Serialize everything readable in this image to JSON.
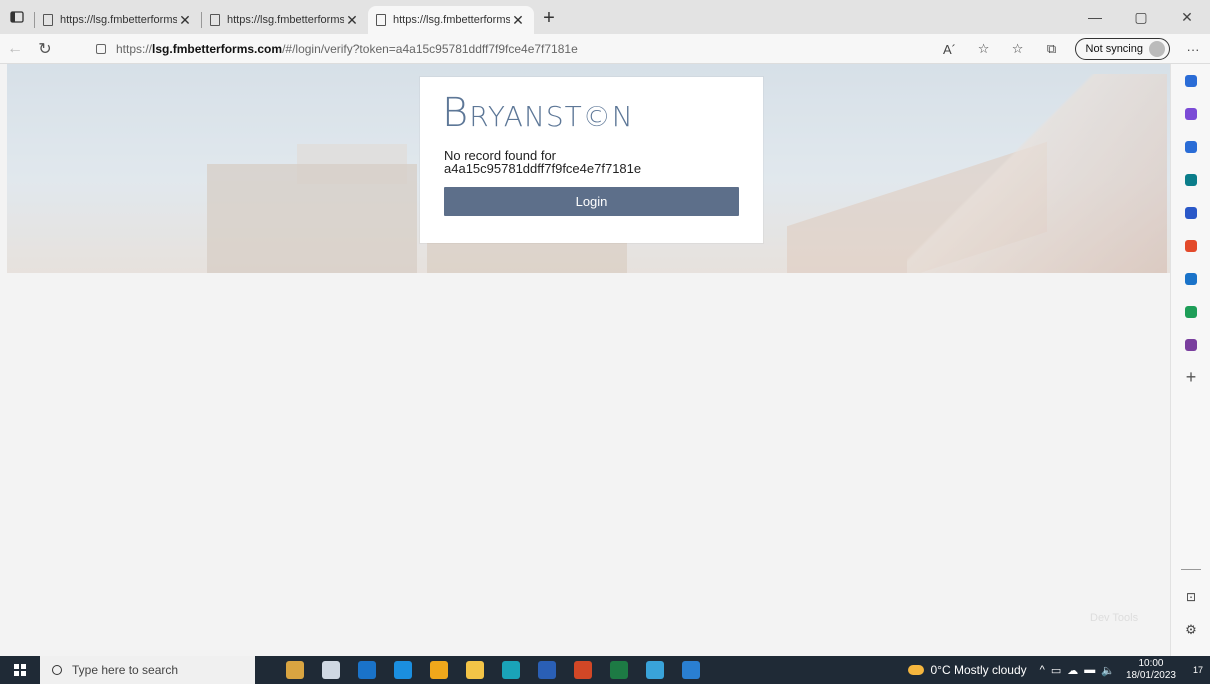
{
  "browser": {
    "tabs": [
      {
        "title": "https://lsg.fmbetterforms.com/#",
        "active": false
      },
      {
        "title": "https://lsg.fmbetterforms.com/#",
        "active": false
      },
      {
        "title": "https://lsg.fmbetterforms.com/#",
        "active": true
      }
    ],
    "new_tab_label": "+",
    "url_prefix": "https://",
    "url_host": "lsg.fmbetterforms.com",
    "url_path": "/#/login/verify?token=a4a15c95781ddff7f9fce4e7f7181e",
    "sync_label": "Not syncing",
    "read_aloud_label": "A´"
  },
  "page": {
    "logo_first": "B",
    "logo_rest": "RYANST©N",
    "message_line1": "No record found for",
    "message_line2": "a4a15c95781ddff7f9fce4e7f7181e",
    "login_button": "Login",
    "devtools_label": "Dev Tools"
  },
  "sidebar": {
    "icons": [
      {
        "name": "search-icon",
        "color": "#2a6cd6"
      },
      {
        "name": "sparkle-icon",
        "color": "#7b4bd6"
      },
      {
        "name": "tag-icon",
        "color": "#2a6cd6"
      },
      {
        "name": "briefcase-icon",
        "color": "#0b7d8a"
      },
      {
        "name": "games-icon",
        "color": "#2a58c8"
      },
      {
        "name": "office-icon",
        "color": "#e34a2b"
      },
      {
        "name": "outlook-icon",
        "color": "#1a73c9"
      },
      {
        "name": "tree-icon",
        "color": "#1e9e58"
      },
      {
        "name": "circle-app-icon",
        "color": "#7a3f9e"
      }
    ],
    "add_label": "+"
  },
  "taskbar": {
    "search_placeholder": "Type here to search",
    "apps": [
      {
        "name": "widget-app",
        "color": "#d9a441"
      },
      {
        "name": "task-view",
        "color": "#cfd8e3"
      },
      {
        "name": "outlook-app",
        "color": "#1a73c9"
      },
      {
        "name": "ie-app",
        "color": "#1b8fe0"
      },
      {
        "name": "chrome-app",
        "color": "#f0a71b"
      },
      {
        "name": "explorer-app",
        "color": "#f3c447"
      },
      {
        "name": "edge-app",
        "color": "#1aa3b8"
      },
      {
        "name": "word-app",
        "color": "#2a5fb5"
      },
      {
        "name": "powerpoint-app",
        "color": "#d24726"
      },
      {
        "name": "excel-app",
        "color": "#1d7a44"
      },
      {
        "name": "snip-app",
        "color": "#39a3d9"
      },
      {
        "name": "s-app",
        "color": "#2a7fd1"
      }
    ],
    "weather_temp": "0°C",
    "weather_desc": "Mostly cloudy",
    "time": "10:00",
    "date": "18/01/2023",
    "notification_count": "17"
  }
}
